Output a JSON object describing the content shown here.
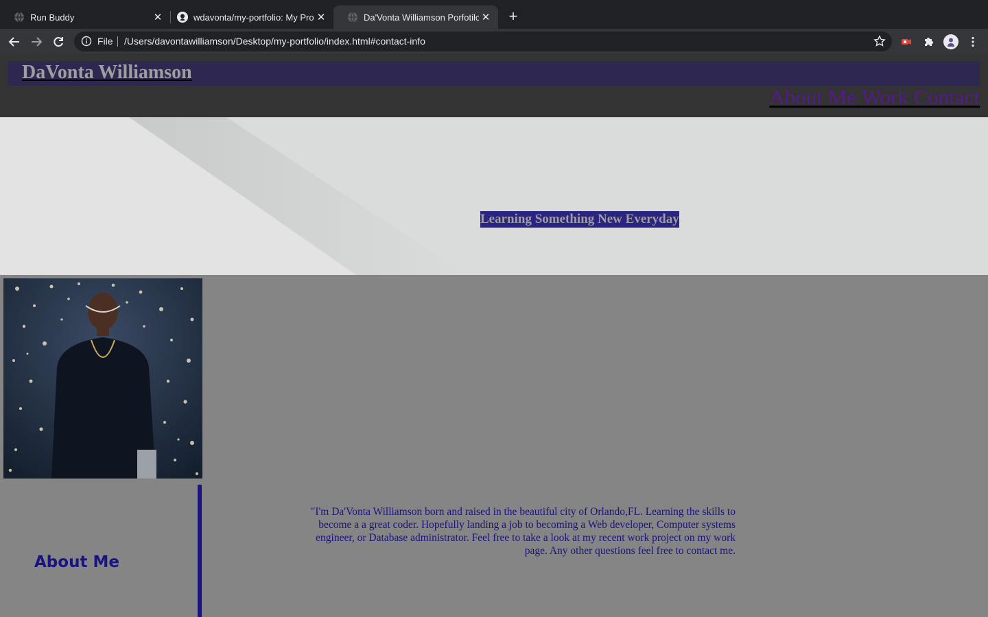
{
  "browser": {
    "tabs": [
      {
        "title": "Run Buddy",
        "active": false
      },
      {
        "title": "wdavonta/my-portfolio: My Pro",
        "active": false
      },
      {
        "title": "Da'Vonta Williamson Porfotilo",
        "active": true
      }
    ],
    "address": {
      "scheme_label": "File",
      "url": "/Users/davontawilliamson/Desktop/my-portfolio/index.html#contact-info"
    }
  },
  "site": {
    "name": "DaVonta Williamson",
    "nav": [
      {
        "label": "About Me"
      },
      {
        "label": "Work"
      },
      {
        "label": "Contact"
      }
    ],
    "hero_tagline": "Learning Something New Everyday",
    "about": {
      "heading": "About Me",
      "bio": "\"I'm Da'Vonta Williamson born and raised in the beautiful city of Orlando,FL. Learning the skills to become a a great coder. Hopefully landing a job to becoming a Web developer, Computer systems engineer, or Database administrator. Feel free to take a look at my recent work project on my work page. Any other questions feel free to contact me."
    }
  },
  "colors": {
    "header_bg": "#333333",
    "name_bar_bg": "#2e2750",
    "accent_blue": "#1a1380",
    "nav_link": "#551a8b",
    "page_bg": "#858585",
    "hero_bg": "#dadcdb"
  },
  "icons": {
    "back": "arrow-left-icon",
    "forward": "arrow-right-icon",
    "reload": "reload-icon",
    "info": "info-icon",
    "star": "star-icon",
    "extensions": "puzzle-icon",
    "menu": "kebab-menu-icon"
  }
}
